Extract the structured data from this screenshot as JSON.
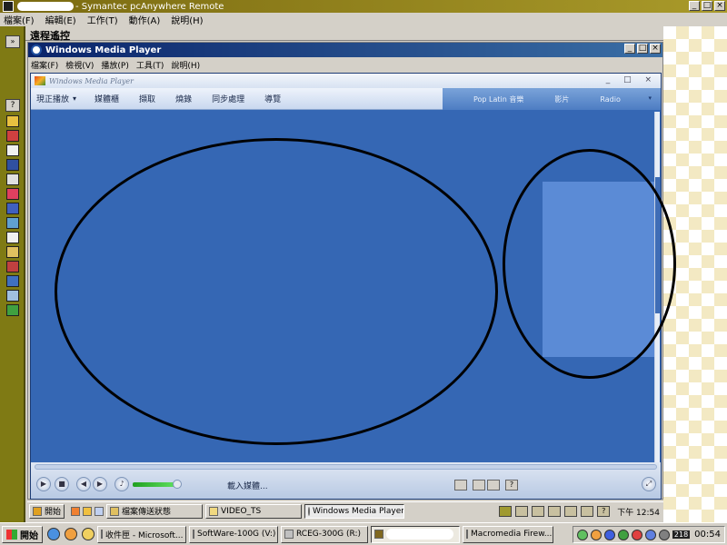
{
  "outer_window": {
    "title": "- Symantec pcAnywhere Remote",
    "menu": [
      "檔案(F)",
      "編輯(E)",
      "工作(T)",
      "動作(A)",
      "說明(H)"
    ],
    "controls": [
      "_",
      "□",
      "×"
    ]
  },
  "remote_header": {
    "title": "遠程遙控"
  },
  "wmp_window": {
    "title": "Windows Media Player",
    "menu": [
      "檔案(F)",
      "檢視(V)",
      "播放(P)",
      "工具(T)",
      "說明(H)"
    ],
    "controls": [
      "_",
      "□",
      "×"
    ]
  },
  "wmp_skin": {
    "title": "Windows Media Player",
    "title_controls": "_ □ ×",
    "tabs": [
      "現正播放",
      "媒體櫃",
      "擷取",
      "燒錄",
      "同步處理",
      "導覽"
    ],
    "store_links": [
      "Pop Latin 音樂",
      "影片",
      "Radio"
    ],
    "status_text": "載入媒體...",
    "dropdown_arrow": "▾"
  },
  "remote_taskbar": {
    "start_label": "開始",
    "buttons": [
      "檔案傳送狀態",
      "VIDEO_TS",
      "Windows Media Player"
    ],
    "clock": "下午 12:54"
  },
  "local_taskbar": {
    "start_label": "開始",
    "buttons": [
      "收件匣 - Microsoft...",
      "SoftWare-100G (V:)",
      "RCEG-300G (R:)",
      "",
      "Macromedia Firew..."
    ],
    "tray_number": "218",
    "clock": "00:54"
  },
  "colors": {
    "wmp_blue": "#3567b4",
    "panel_blue": "#5b8bd6",
    "olive_toolbar": "#7f7a14"
  }
}
